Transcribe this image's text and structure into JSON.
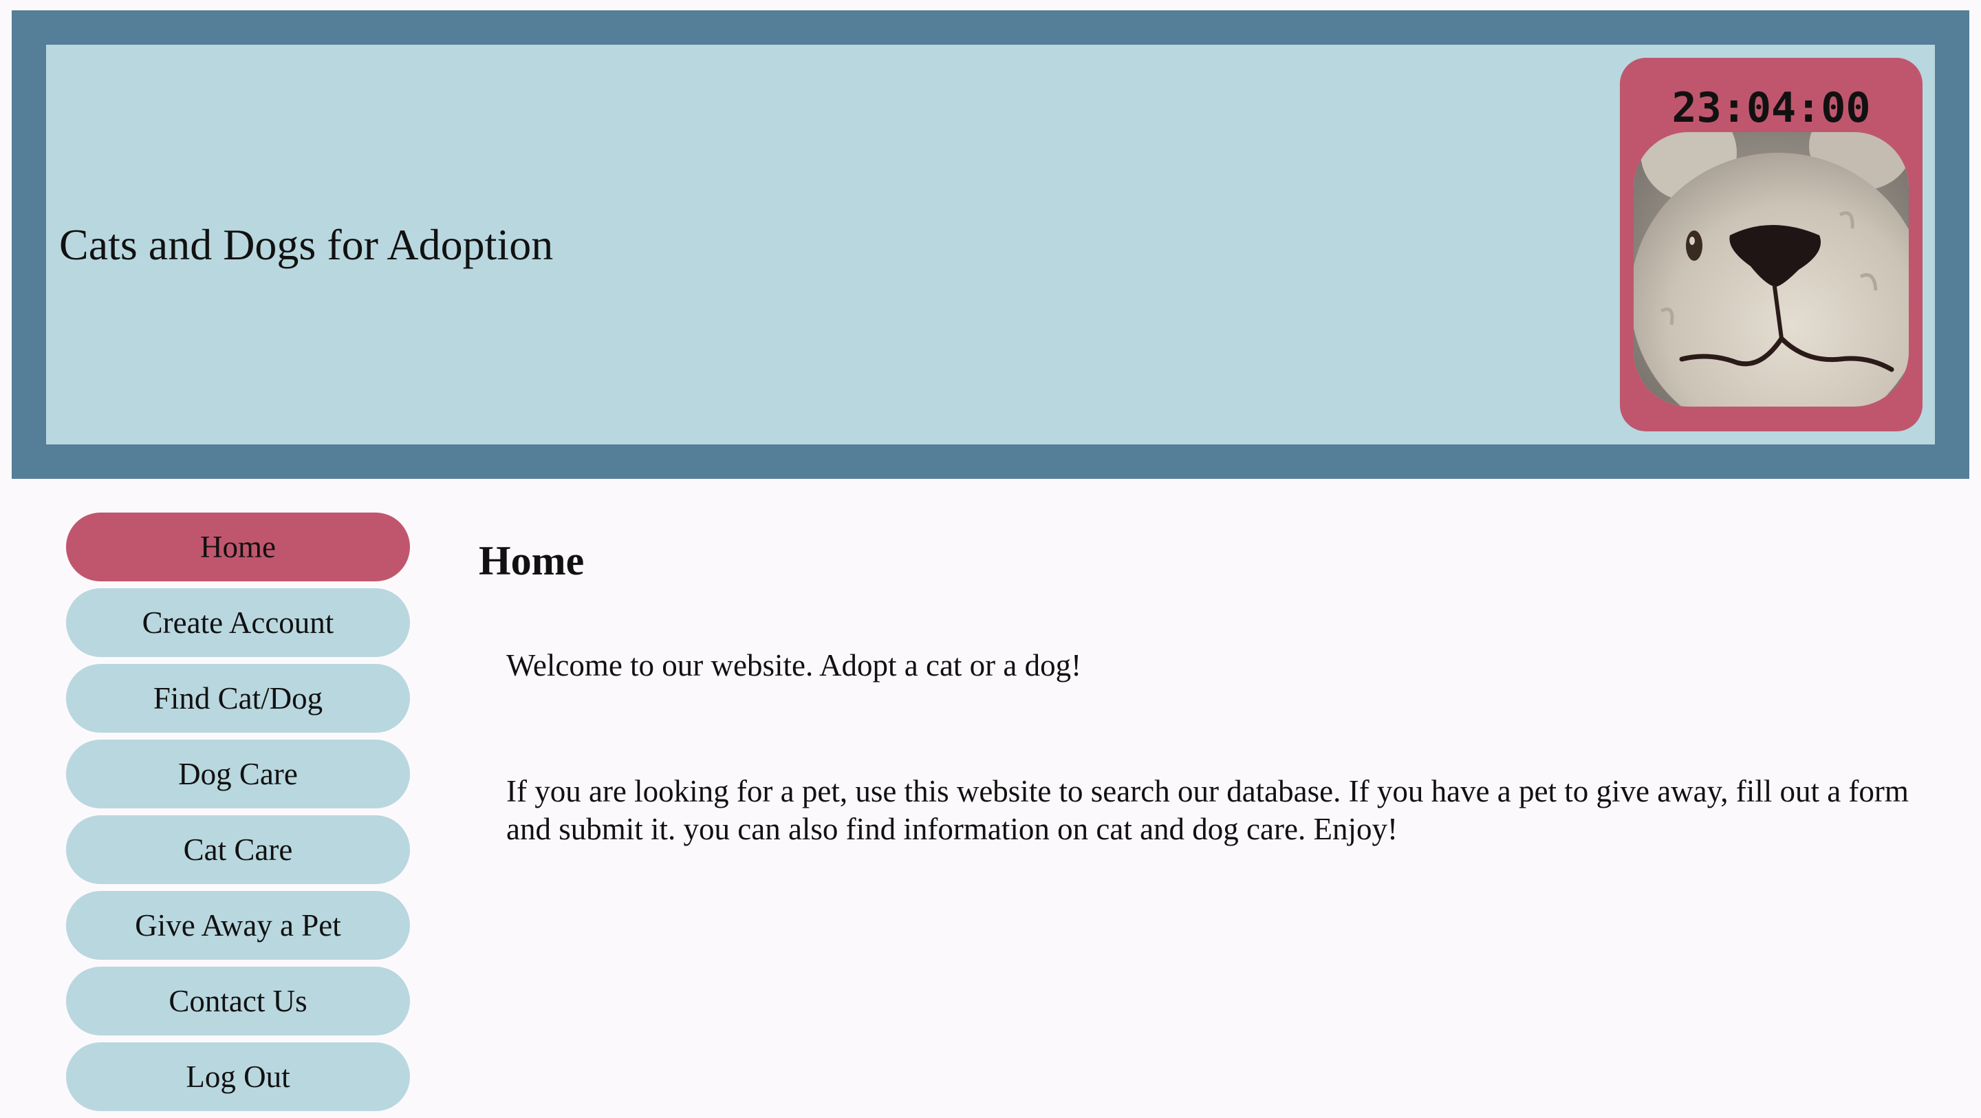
{
  "header": {
    "title": "Cats and Dogs for Adoption",
    "clock": "23:04:00",
    "photo_icon": "plush-bunny-photo"
  },
  "nav": {
    "items": [
      {
        "label": "Home",
        "active": true
      },
      {
        "label": "Create Account",
        "active": false
      },
      {
        "label": "Find Cat/Dog",
        "active": false
      },
      {
        "label": "Dog Care",
        "active": false
      },
      {
        "label": "Cat Care",
        "active": false
      },
      {
        "label": "Give Away a Pet",
        "active": false
      },
      {
        "label": "Contact Us",
        "active": false
      },
      {
        "label": "Log Out",
        "active": false
      }
    ]
  },
  "main": {
    "heading": "Home",
    "paragraphs": [
      "Welcome to our website. Adopt a cat or a dog!",
      "If you are looking for a pet, use this website to search our database. If you have a pet to give away, fill out a form and submit it. you can also find information on cat and dog care. Enjoy!"
    ]
  },
  "colors": {
    "header_outer": "#557e98",
    "header_inner": "#b9d7df",
    "accent": "#c0566d",
    "nav_bg": "#b9d7df",
    "page_bg": "#fcf9fc"
  }
}
